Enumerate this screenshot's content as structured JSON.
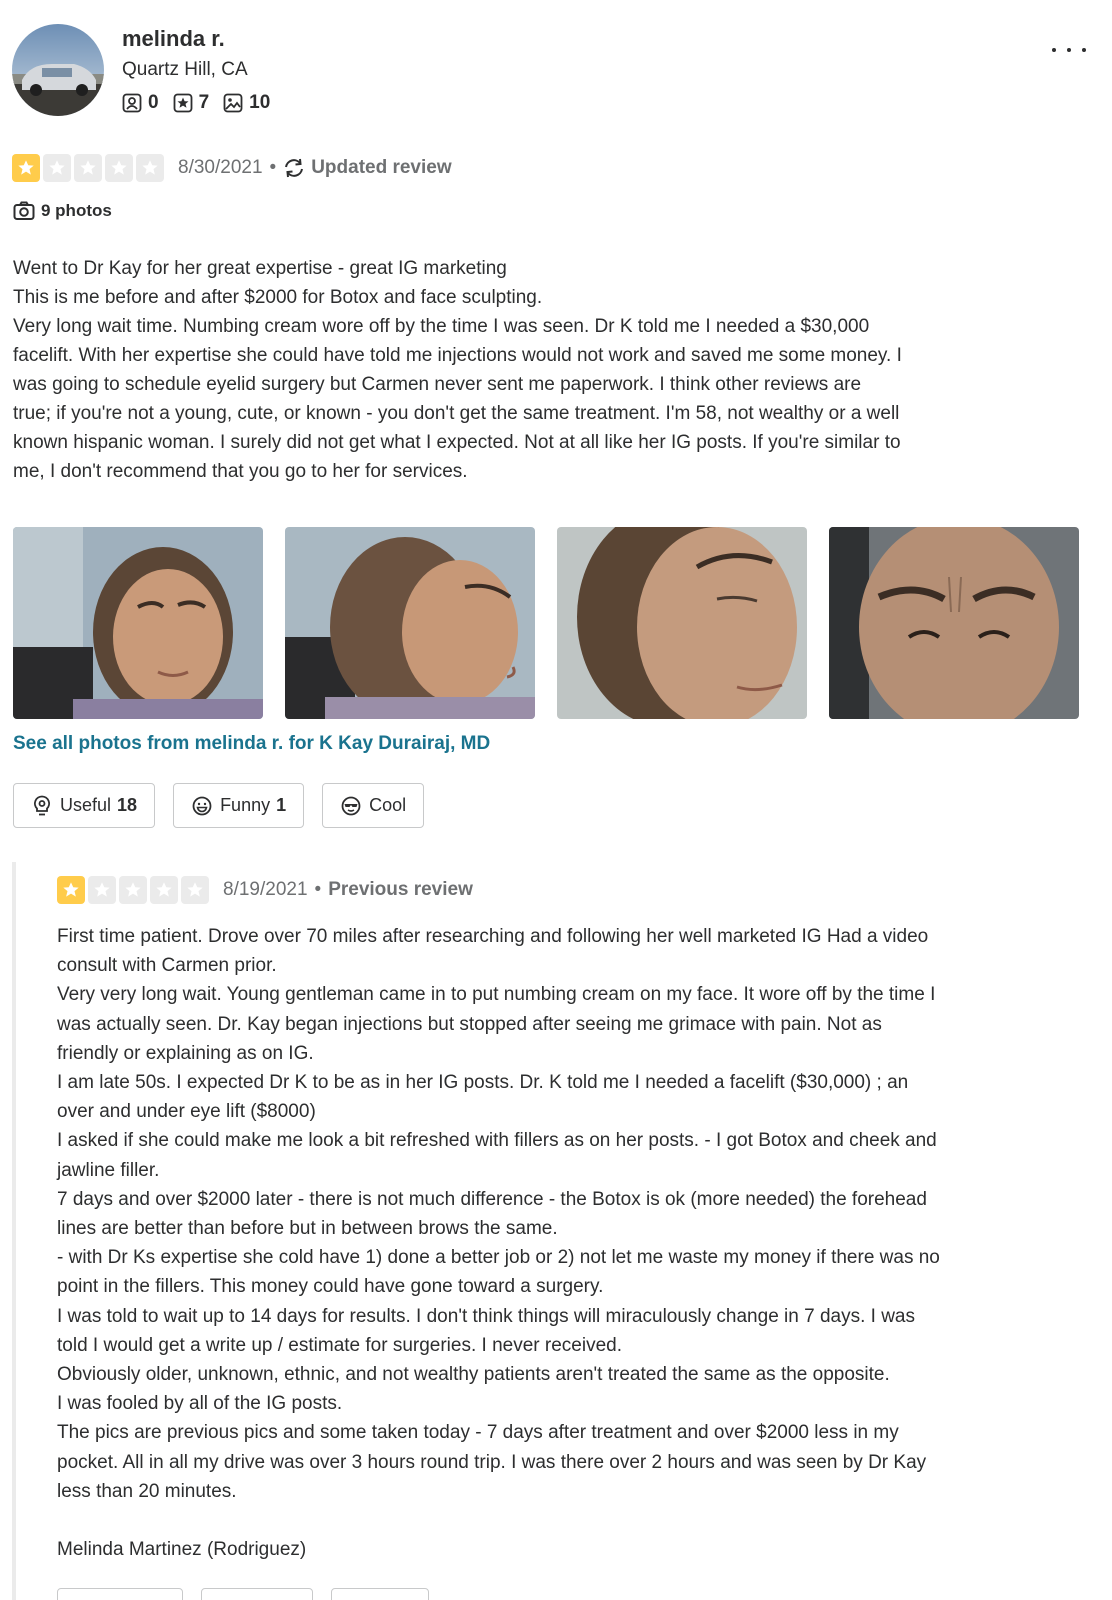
{
  "user": {
    "name": "melinda r.",
    "location": "Quartz Hill, CA",
    "friends": "0",
    "reviews": "7",
    "photos": "10"
  },
  "review": {
    "rating": 1,
    "date": "8/30/2021",
    "separator": "•",
    "status": "Updated review",
    "photos_label": "9 photos",
    "text_lines": [
      "Went to Dr Kay for her great expertise - great IG marketing",
      "This is me before and after $2000 for Botox and face sculpting.",
      "Very long wait time. Numbing cream wore off by the time I was seen. Dr K told me I needed a $30,000",
      "facelift. With her expertise she could have told me injections would not work and saved me some money. I",
      "was going to schedule eyelid surgery but Carmen never sent me paperwork. I think other reviews are",
      "true; if you're not a young, cute, or known - you don't get the same treatment. I'm 58, not wealthy or a well",
      "known hispanic woman. I surely did not get what I expected. Not at all like her IG posts. If you're similar to",
      "me, I don't recommend that you go to her for services."
    ],
    "see_all_link": "See all photos from melinda r. for K Kay Durairaj, MD",
    "reactions": {
      "useful_label": "Useful",
      "useful_count": "18",
      "funny_label": "Funny",
      "funny_count": "1",
      "cool_label": "Cool"
    }
  },
  "previous_review": {
    "rating": 1,
    "date": "8/19/2021",
    "separator": "•",
    "status": "Previous review",
    "text_lines": [
      "First time patient. Drove over 70 miles after researching and following her well marketed IG Had a video",
      "consult with Carmen prior.",
      "Very very long wait. Young gentleman came in to put numbing cream on my face.  It wore off by the time I",
      "was actually seen.  Dr. Kay began injections but stopped after seeing me grimace with pain.  Not as",
      "friendly or explaining as on IG.",
      "I am late 50s. I expected Dr K to be as in her IG posts. Dr. K told me I needed a facelift ($30,000) ; an",
      "over and under eye lift ($8000)",
      "I asked if she could make me look a bit refreshed with fillers as on her posts. - I got Botox and cheek and",
      "jawline filler.",
      "7 days and over $2000 later - there is not much difference - the Botox is ok (more needed) the forehead",
      "lines are better than before but in between brows the same.",
      "- with Dr Ks expertise she cold have 1) done a better job or 2) not let me waste my money if there was no",
      "point in the fillers. This money could have gone toward a surgery.",
      "I was told to wait up to 14 days for results. I don't think things will miraculously change in 7 days. I was",
      "told I would get a write up / estimate for surgeries. I never received.",
      "Obviously older, unknown, ethnic, and not wealthy patients aren't treated the same as the opposite.",
      "I was fooled by all of the IG posts.",
      "The pics are previous pics and some taken today - 7 days after treatment and over $2000 less in my",
      "pocket. All in all my drive was over 3 hours round trip.  I was there over 2 hours and was seen by Dr Kay",
      "less than 20 minutes.",
      "",
      "Melinda Martinez (Rodriguez)"
    ]
  },
  "icons": {
    "friends": "person-icon",
    "reviews": "star-badge-icon",
    "photos": "image-icon",
    "updated": "refresh-icon",
    "camera": "camera-icon",
    "useful": "lightbulb-icon",
    "funny": "smile-icon",
    "cool": "sunglasses-icon",
    "more": "more-dots-icon"
  },
  "colors": {
    "star_on": "#ffcc4b",
    "star_off": "#ebebeb",
    "link": "#1a738e",
    "text": "#2d2e2f",
    "muted": "#6e7072"
  }
}
